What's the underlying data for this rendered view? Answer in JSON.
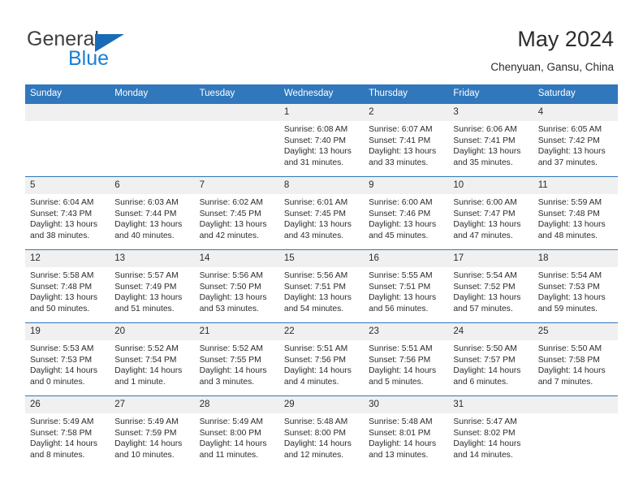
{
  "brand": {
    "name_top": "General",
    "name_bottom": "Blue",
    "accent_color": "#1a7fd4",
    "triangle_color": "#1a6bb5",
    "triangle_icon": "triangle-icon"
  },
  "header": {
    "title": "May 2024",
    "subtitle": "Chenyuan, Gansu, China"
  },
  "theme": {
    "header_row_bg": "#3077bc",
    "daynum_bg": "#f0f0f0",
    "text": "#2b2b2b"
  },
  "weekdays": [
    "Sunday",
    "Monday",
    "Tuesday",
    "Wednesday",
    "Thursday",
    "Friday",
    "Saturday"
  ],
  "weeks": [
    [
      {
        "day": "",
        "sunrise": "",
        "sunset": "",
        "daylight": ""
      },
      {
        "day": "",
        "sunrise": "",
        "sunset": "",
        "daylight": ""
      },
      {
        "day": "",
        "sunrise": "",
        "sunset": "",
        "daylight": ""
      },
      {
        "day": "1",
        "sunrise": "Sunrise: 6:08 AM",
        "sunset": "Sunset: 7:40 PM",
        "daylight": "Daylight: 13 hours and 31 minutes."
      },
      {
        "day": "2",
        "sunrise": "Sunrise: 6:07 AM",
        "sunset": "Sunset: 7:41 PM",
        "daylight": "Daylight: 13 hours and 33 minutes."
      },
      {
        "day": "3",
        "sunrise": "Sunrise: 6:06 AM",
        "sunset": "Sunset: 7:41 PM",
        "daylight": "Daylight: 13 hours and 35 minutes."
      },
      {
        "day": "4",
        "sunrise": "Sunrise: 6:05 AM",
        "sunset": "Sunset: 7:42 PM",
        "daylight": "Daylight: 13 hours and 37 minutes."
      }
    ],
    [
      {
        "day": "5",
        "sunrise": "Sunrise: 6:04 AM",
        "sunset": "Sunset: 7:43 PM",
        "daylight": "Daylight: 13 hours and 38 minutes."
      },
      {
        "day": "6",
        "sunrise": "Sunrise: 6:03 AM",
        "sunset": "Sunset: 7:44 PM",
        "daylight": "Daylight: 13 hours and 40 minutes."
      },
      {
        "day": "7",
        "sunrise": "Sunrise: 6:02 AM",
        "sunset": "Sunset: 7:45 PM",
        "daylight": "Daylight: 13 hours and 42 minutes."
      },
      {
        "day": "8",
        "sunrise": "Sunrise: 6:01 AM",
        "sunset": "Sunset: 7:45 PM",
        "daylight": "Daylight: 13 hours and 43 minutes."
      },
      {
        "day": "9",
        "sunrise": "Sunrise: 6:00 AM",
        "sunset": "Sunset: 7:46 PM",
        "daylight": "Daylight: 13 hours and 45 minutes."
      },
      {
        "day": "10",
        "sunrise": "Sunrise: 6:00 AM",
        "sunset": "Sunset: 7:47 PM",
        "daylight": "Daylight: 13 hours and 47 minutes."
      },
      {
        "day": "11",
        "sunrise": "Sunrise: 5:59 AM",
        "sunset": "Sunset: 7:48 PM",
        "daylight": "Daylight: 13 hours and 48 minutes."
      }
    ],
    [
      {
        "day": "12",
        "sunrise": "Sunrise: 5:58 AM",
        "sunset": "Sunset: 7:48 PM",
        "daylight": "Daylight: 13 hours and 50 minutes."
      },
      {
        "day": "13",
        "sunrise": "Sunrise: 5:57 AM",
        "sunset": "Sunset: 7:49 PM",
        "daylight": "Daylight: 13 hours and 51 minutes."
      },
      {
        "day": "14",
        "sunrise": "Sunrise: 5:56 AM",
        "sunset": "Sunset: 7:50 PM",
        "daylight": "Daylight: 13 hours and 53 minutes."
      },
      {
        "day": "15",
        "sunrise": "Sunrise: 5:56 AM",
        "sunset": "Sunset: 7:51 PM",
        "daylight": "Daylight: 13 hours and 54 minutes."
      },
      {
        "day": "16",
        "sunrise": "Sunrise: 5:55 AM",
        "sunset": "Sunset: 7:51 PM",
        "daylight": "Daylight: 13 hours and 56 minutes."
      },
      {
        "day": "17",
        "sunrise": "Sunrise: 5:54 AM",
        "sunset": "Sunset: 7:52 PM",
        "daylight": "Daylight: 13 hours and 57 minutes."
      },
      {
        "day": "18",
        "sunrise": "Sunrise: 5:54 AM",
        "sunset": "Sunset: 7:53 PM",
        "daylight": "Daylight: 13 hours and 59 minutes."
      }
    ],
    [
      {
        "day": "19",
        "sunrise": "Sunrise: 5:53 AM",
        "sunset": "Sunset: 7:53 PM",
        "daylight": "Daylight: 14 hours and 0 minutes."
      },
      {
        "day": "20",
        "sunrise": "Sunrise: 5:52 AM",
        "sunset": "Sunset: 7:54 PM",
        "daylight": "Daylight: 14 hours and 1 minute."
      },
      {
        "day": "21",
        "sunrise": "Sunrise: 5:52 AM",
        "sunset": "Sunset: 7:55 PM",
        "daylight": "Daylight: 14 hours and 3 minutes."
      },
      {
        "day": "22",
        "sunrise": "Sunrise: 5:51 AM",
        "sunset": "Sunset: 7:56 PM",
        "daylight": "Daylight: 14 hours and 4 minutes."
      },
      {
        "day": "23",
        "sunrise": "Sunrise: 5:51 AM",
        "sunset": "Sunset: 7:56 PM",
        "daylight": "Daylight: 14 hours and 5 minutes."
      },
      {
        "day": "24",
        "sunrise": "Sunrise: 5:50 AM",
        "sunset": "Sunset: 7:57 PM",
        "daylight": "Daylight: 14 hours and 6 minutes."
      },
      {
        "day": "25",
        "sunrise": "Sunrise: 5:50 AM",
        "sunset": "Sunset: 7:58 PM",
        "daylight": "Daylight: 14 hours and 7 minutes."
      }
    ],
    [
      {
        "day": "26",
        "sunrise": "Sunrise: 5:49 AM",
        "sunset": "Sunset: 7:58 PM",
        "daylight": "Daylight: 14 hours and 8 minutes."
      },
      {
        "day": "27",
        "sunrise": "Sunrise: 5:49 AM",
        "sunset": "Sunset: 7:59 PM",
        "daylight": "Daylight: 14 hours and 10 minutes."
      },
      {
        "day": "28",
        "sunrise": "Sunrise: 5:49 AM",
        "sunset": "Sunset: 8:00 PM",
        "daylight": "Daylight: 14 hours and 11 minutes."
      },
      {
        "day": "29",
        "sunrise": "Sunrise: 5:48 AM",
        "sunset": "Sunset: 8:00 PM",
        "daylight": "Daylight: 14 hours and 12 minutes."
      },
      {
        "day": "30",
        "sunrise": "Sunrise: 5:48 AM",
        "sunset": "Sunset: 8:01 PM",
        "daylight": "Daylight: 14 hours and 13 minutes."
      },
      {
        "day": "31",
        "sunrise": "Sunrise: 5:47 AM",
        "sunset": "Sunset: 8:02 PM",
        "daylight": "Daylight: 14 hours and 14 minutes."
      },
      {
        "day": "",
        "sunrise": "",
        "sunset": "",
        "daylight": ""
      }
    ]
  ]
}
